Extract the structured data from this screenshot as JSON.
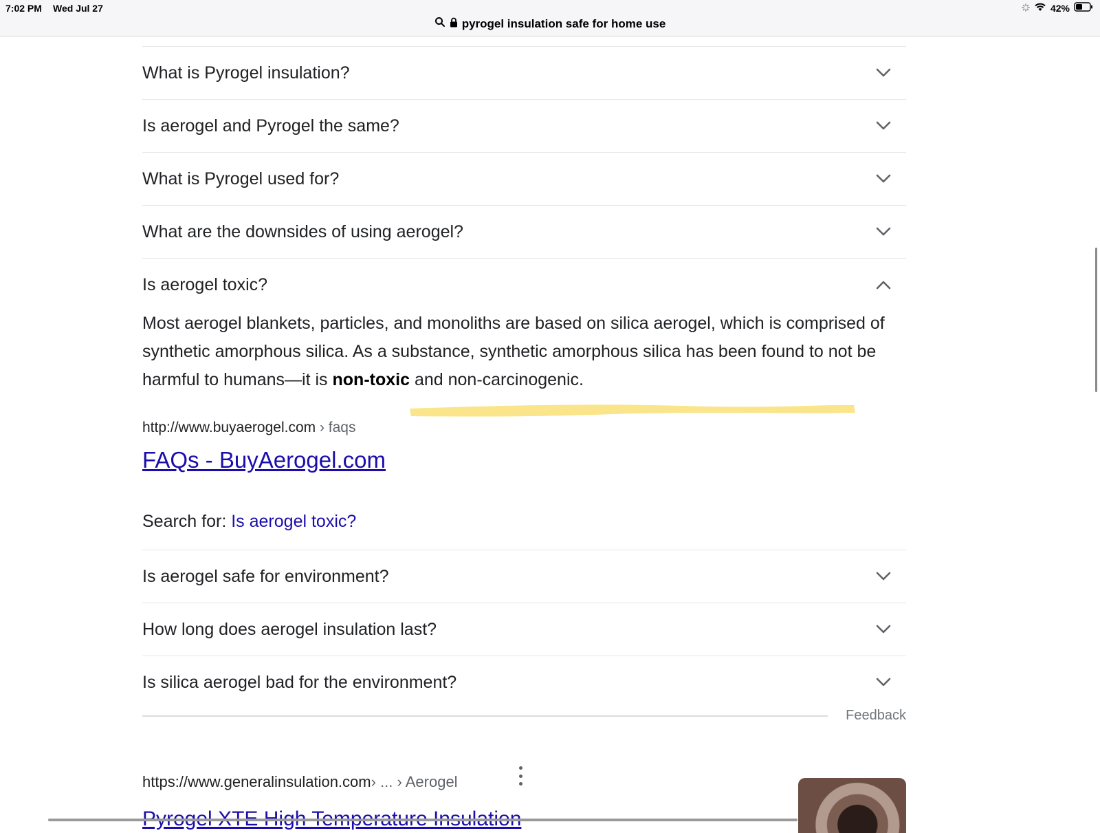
{
  "status_bar": {
    "time": "7:02 PM",
    "date": "Wed Jul 27",
    "battery": "42%"
  },
  "address_bar": {
    "query": "pyrogel insulation safe for home use"
  },
  "faq_top": [
    {
      "question": "What is Pyrogel insulation?",
      "expanded": false
    },
    {
      "question": "Is aerogel and Pyrogel the same?",
      "expanded": false
    },
    {
      "question": "What is Pyrogel used for?",
      "expanded": false
    },
    {
      "question": "What are the downsides of using aerogel?",
      "expanded": false
    },
    {
      "question": "Is aerogel toxic?",
      "expanded": true
    }
  ],
  "answer": {
    "text_before": "Most aerogel blankets, particles, and monoliths are based on silica aerogel, which is comprised of synthetic amorphous silica. As a substance, synthetic amorphous silica has been found to not be harmful to humans—it is ",
    "bold": "non-toxic",
    "text_after": " and non-carcinogenic.",
    "highlight_color": "#f9e27d",
    "source_url": "http://www.buyaerogel.com",
    "source_crumb": " › faqs",
    "link_title": "FAQs - BuyAerogel.com",
    "search_for_label": "Search for: ",
    "search_for_query": "Is aerogel toxic?"
  },
  "faq_bottom": [
    {
      "question": "Is aerogel safe for environment?",
      "expanded": false
    },
    {
      "question": "How long does aerogel insulation last?",
      "expanded": false
    },
    {
      "question": "Is silica aerogel bad for the environment?",
      "expanded": false
    }
  ],
  "feedback_label": "Feedback",
  "next_result": {
    "url": "https://www.generalinsulation.com",
    "crumb": " › ... › Aerogel",
    "title": "Pyrogel XTE High Temperature Insulation"
  },
  "colors": {
    "link": "#1a0dab",
    "text": "#202124",
    "muted": "#5f6368"
  }
}
